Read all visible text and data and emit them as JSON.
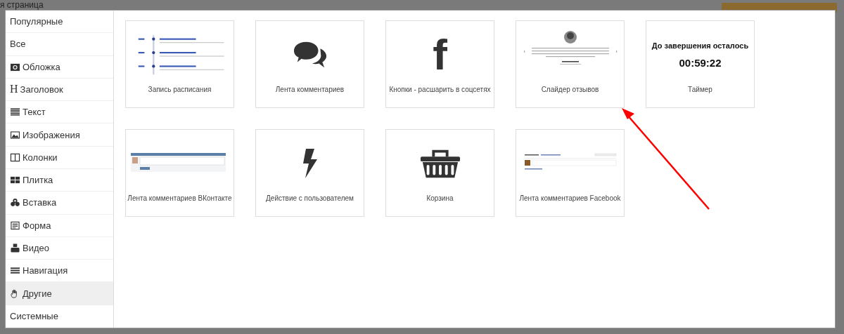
{
  "backdrop": {
    "page_title": "я страница"
  },
  "sidebar": {
    "items": [
      {
        "label": "Популярные",
        "selected": false
      },
      {
        "label": "Все",
        "selected": false
      },
      {
        "label": "Обложка",
        "selected": false
      },
      {
        "label": "Заголовок",
        "selected": false,
        "glyph": "H"
      },
      {
        "label": "Текст",
        "selected": false
      },
      {
        "label": "Изображения",
        "selected": false
      },
      {
        "label": "Колонки",
        "selected": false
      },
      {
        "label": "Плитка",
        "selected": false
      },
      {
        "label": "Вставка",
        "selected": false
      },
      {
        "label": "Форма",
        "selected": false
      },
      {
        "label": "Видео",
        "selected": false
      },
      {
        "label": "Навигация",
        "selected": false
      },
      {
        "label": "Другие",
        "selected": true
      },
      {
        "label": "Системные",
        "selected": false
      }
    ]
  },
  "blocks": [
    {
      "kind": "schedule",
      "label": "Запись расписания"
    },
    {
      "kind": "comments",
      "label": "Лента комментариев"
    },
    {
      "kind": "share",
      "label": "Кнопки - расшарить в соцсетях",
      "glyph": "f"
    },
    {
      "kind": "reviews",
      "label": "Слайдер отзывов"
    },
    {
      "kind": "timer",
      "label": "Таймер",
      "heading": "До завершения осталось",
      "time": "00:59:22"
    },
    {
      "kind": "vk",
      "label": "Лента комментариев ВКонтакте"
    },
    {
      "kind": "action",
      "label": "Действие с пользователем"
    },
    {
      "kind": "cart",
      "label": "Корзина"
    },
    {
      "kind": "facebook",
      "label": "Лента комментариев Facebook"
    }
  ]
}
